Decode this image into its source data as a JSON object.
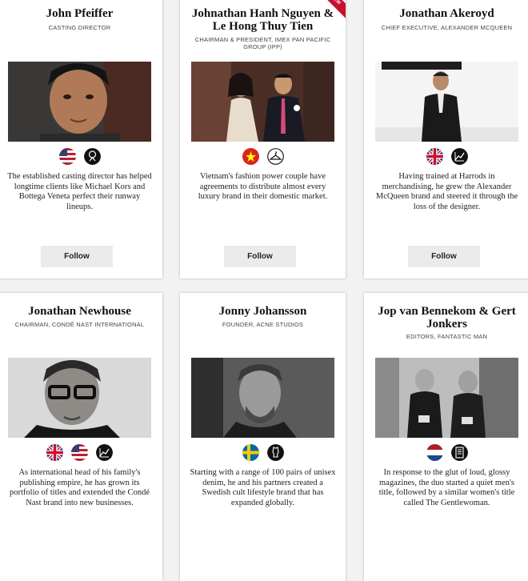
{
  "follow_label": "Follow",
  "cards": [
    {
      "name": "John Pfeiffer",
      "role": "CASTING DIRECTOR",
      "icons": [
        "us-flag-icon",
        "casting-reel-icon"
      ],
      "description": "The established casting director has helped longtime clients like Michael Kors and Bottega Veneta perfect their runway lineups."
    },
    {
      "name": "Johnathan Hanh Nguyen & Le Hong Thuy Tien",
      "role": "CHAIRMAN & PRESIDENT, IMEX PAN PACIFIC GROUP (IPP)",
      "badge": "NEW",
      "icons": [
        "vietnam-flag-icon",
        "hanger-icon"
      ],
      "description": "Vietnam's fashion power couple have agreements to distribute almost every luxury brand in their domestic market."
    },
    {
      "name": "Jonathan Akeroyd",
      "role": "CHIEF EXECUTIVE, ALEXANDER MCQUEEN",
      "icons": [
        "uk-flag-icon",
        "growth-chart-icon"
      ],
      "description": "Having trained at Harrods in merchandising, he grew the Alexander McQueen brand and steered it through the loss of the designer."
    },
    {
      "name": "Jonathan Newhouse",
      "role": "CHAIRMAN, CONDÉ NAST INTERNATIONAL",
      "icons": [
        "uk-flag-icon",
        "us-flag-icon",
        "growth-chart-icon"
      ],
      "description": "As international head of his family's publishing empire, he has grown its portfolio of titles and extended the Condé Nast brand into new businesses."
    },
    {
      "name": "Jonny Johansson",
      "role": "FOUNDER, ACNE STUDIOS",
      "icons": [
        "sweden-flag-icon",
        "dress-form-icon"
      ],
      "description": "Starting with a range of 100 pairs of unisex denim, he and his partners created a Swedish cult lifestyle brand that has expanded globally."
    },
    {
      "name": "Jop van Bennekom & Gert Jonkers",
      "role": "EDITORS, FANTASTIC MAN",
      "icons": [
        "netherlands-flag-icon",
        "magazine-icon"
      ],
      "description": "In response to the glut of loud, glossy magazines, the duo started a quiet men's title, followed by a similar women's title called The Gentlewoman."
    }
  ]
}
